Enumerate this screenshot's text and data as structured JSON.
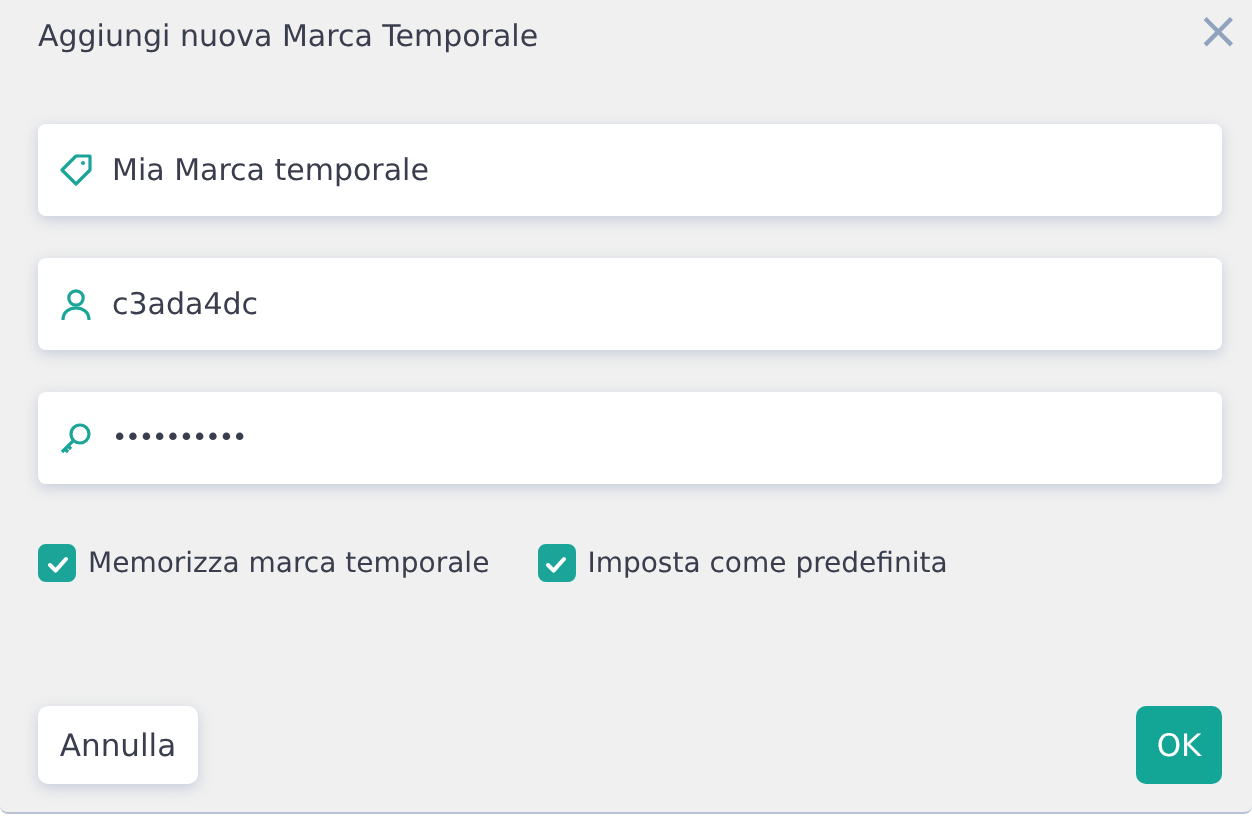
{
  "dialog": {
    "title": "Aggiungi nuova Marca Temporale",
    "close": "×"
  },
  "fields": [
    {
      "kind": "tag",
      "value": "Mia Marca temporale"
    },
    {
      "kind": "user",
      "value": "c3ada4dc"
    },
    {
      "kind": "key",
      "value": "••••••••••"
    }
  ],
  "checkboxes": [
    {
      "label": "Memorizza marca temporale",
      "checked": true
    },
    {
      "label": "Imposta come predefinita",
      "checked": true
    }
  ],
  "buttons": {
    "cancel": "Annulla",
    "ok": "OK"
  }
}
